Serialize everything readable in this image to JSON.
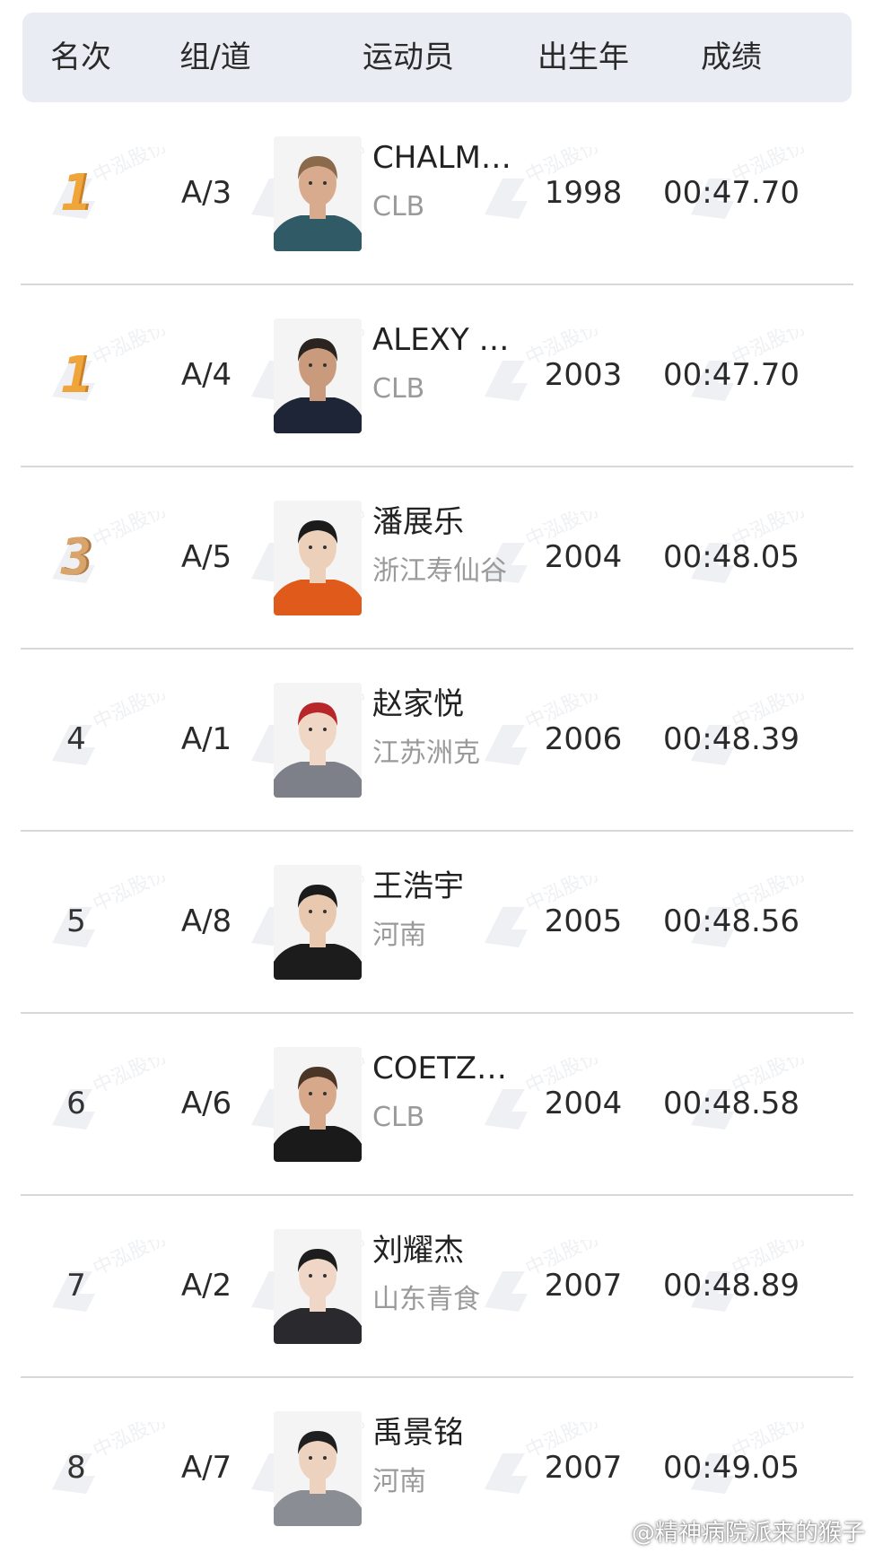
{
  "header": {
    "rank": "名次",
    "lane": "组/道",
    "athlete": "运动员",
    "birth_year": "出生年",
    "result": "成绩"
  },
  "colors": {
    "header_bg": "#e9ecf3",
    "gold": "#f0a53a",
    "bronze": "#d9a46b",
    "team_text": "#9a9a9a"
  },
  "rows": [
    {
      "rank": "1",
      "medal": "gold",
      "lane": "A/3",
      "name": "CHALM…",
      "team": "CLB",
      "year": "1998",
      "result": "00:47.70",
      "photo": {
        "skin": "#d9ab8e",
        "hair": "#8a6a4a",
        "shirt": "#2f5a66"
      }
    },
    {
      "rank": "1",
      "medal": "gold",
      "lane": "A/4",
      "name": "ALEXY …",
      "team": "CLB",
      "year": "2003",
      "result": "00:47.70",
      "photo": {
        "skin": "#c99b7c",
        "hair": "#2b2320",
        "shirt": "#1d2537"
      }
    },
    {
      "rank": "3",
      "medal": "bronze",
      "lane": "A/5",
      "name": "潘展乐",
      "team": "浙江寿仙谷",
      "year": "2004",
      "result": "00:48.05",
      "photo": {
        "skin": "#ecd0ba",
        "hair": "#1b1b1b",
        "shirt": "#e05a1c"
      }
    },
    {
      "rank": "4",
      "medal": "",
      "lane": "A/1",
      "name": "赵家悦",
      "team": "江苏洲克",
      "year": "2006",
      "result": "00:48.39",
      "photo": {
        "skin": "#f0d6c4",
        "hair": "#b8262a",
        "shirt": "#7d8088"
      }
    },
    {
      "rank": "5",
      "medal": "",
      "lane": "A/8",
      "name": "王浩宇",
      "team": "河南",
      "year": "2005",
      "result": "00:48.56",
      "photo": {
        "skin": "#e8c9b0",
        "hair": "#1b1b1b",
        "shirt": "#1c1c1c"
      }
    },
    {
      "rank": "6",
      "medal": "",
      "lane": "A/6",
      "name": "COETZ…",
      "team": "CLB",
      "year": "2004",
      "result": "00:48.58",
      "photo": {
        "skin": "#d8a88a",
        "hair": "#4a3526",
        "shirt": "#1a1a1a"
      }
    },
    {
      "rank": "7",
      "medal": "",
      "lane": "A/2",
      "name": "刘耀杰",
      "team": "山东青食",
      "year": "2007",
      "result": "00:48.89",
      "photo": {
        "skin": "#efd6c6",
        "hair": "#1d1d1d",
        "shirt": "#2a2a2e"
      }
    },
    {
      "rank": "8",
      "medal": "",
      "lane": "A/7",
      "name": "禹景铭",
      "team": "河南",
      "year": "2007",
      "result": "00:49.05",
      "photo": {
        "skin": "#ecd2bf",
        "hair": "#1f1f1f",
        "shirt": "#8a8d94"
      }
    }
  ],
  "watermark_text": "中泓股份",
  "credit": "@精神病院派来的猴子"
}
